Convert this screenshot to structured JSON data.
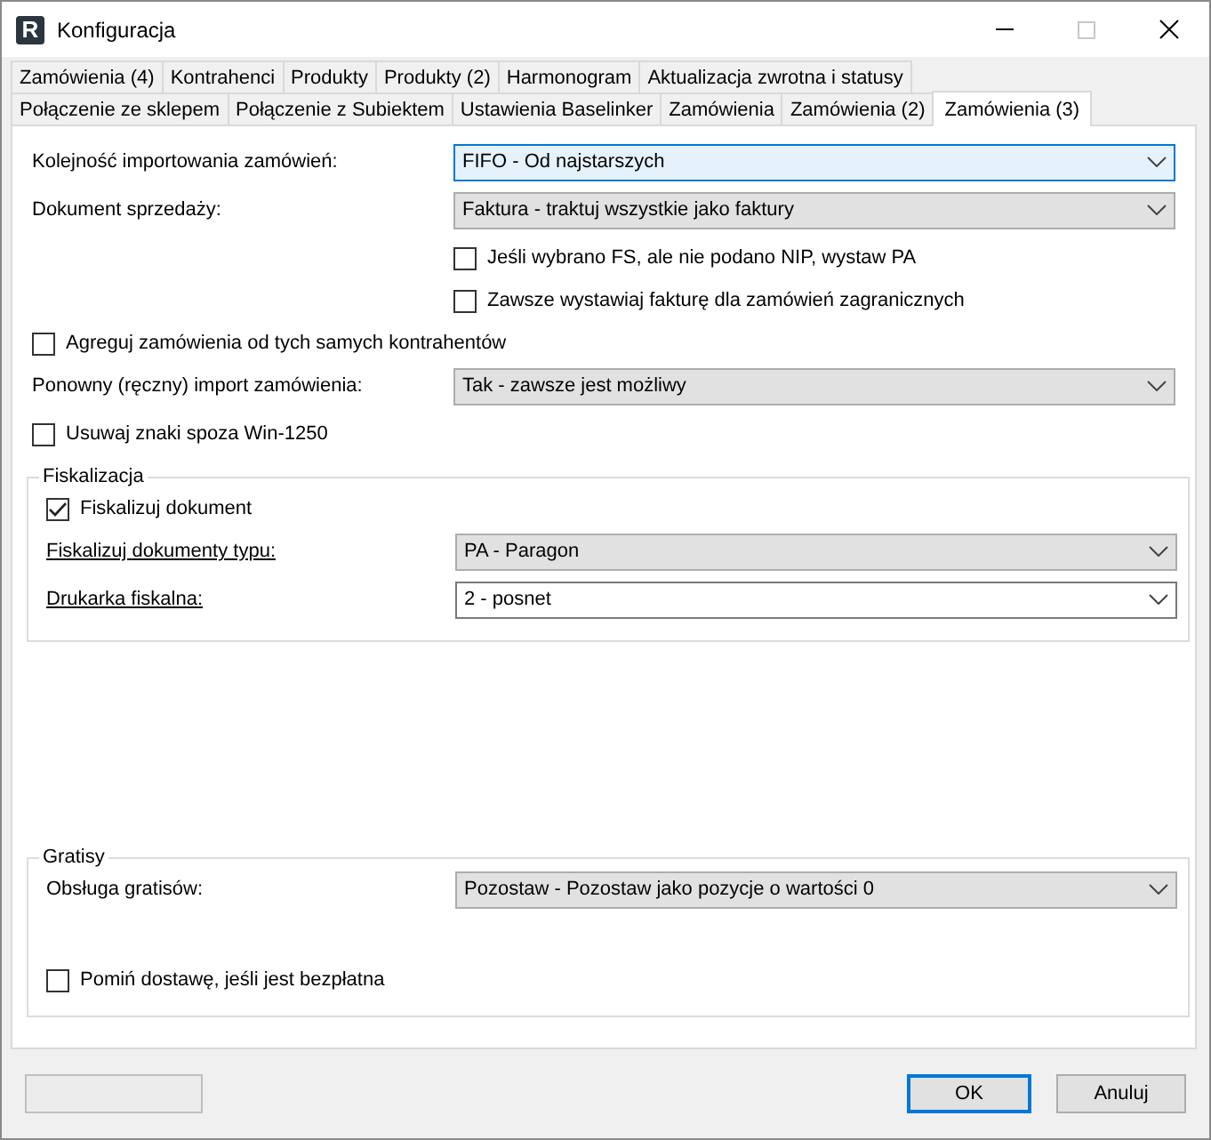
{
  "window": {
    "logo": "R",
    "title": "Konfiguracja"
  },
  "tab_rows": [
    {
      "tabs": [
        {
          "label": "Zamówienia (4)",
          "selected": false
        },
        {
          "label": "Kontrahenci",
          "selected": false
        },
        {
          "label": "Produkty",
          "selected": false
        },
        {
          "label": "Produkty (2)",
          "selected": false
        },
        {
          "label": "Harmonogram",
          "selected": false
        },
        {
          "label": "Aktualizacja zwrotna i statusy",
          "selected": false
        }
      ]
    },
    {
      "tabs": [
        {
          "label": "Połączenie ze sklepem",
          "selected": false
        },
        {
          "label": "Połączenie z Subiektem",
          "selected": false
        },
        {
          "label": "Ustawienia Baselinker",
          "selected": false
        },
        {
          "label": "Zamówienia",
          "selected": false
        },
        {
          "label": "Zamówienia (2)",
          "selected": false
        },
        {
          "label": "Zamówienia (3)",
          "selected": true
        }
      ]
    }
  ],
  "settings": [
    {
      "kind": "combo",
      "label": "Kolejność importowania zamówień:",
      "value": "FIFO - Od najstarszych",
      "focused": true,
      "editable": false,
      "underlined": false
    },
    {
      "kind": "combo",
      "label": "Dokument sprzedaży:",
      "value": "Faktura - traktuj wszystkie jako faktury",
      "focused": false,
      "editable": false,
      "underlined": false
    },
    {
      "kind": "option",
      "label": "Jeśli wybrano FS, ale nie podano NIP, wystaw PA",
      "checked": false
    },
    {
      "kind": "option",
      "label": "Zawsze wystawiaj fakturę dla zamówień zagranicznych",
      "checked": false
    },
    {
      "kind": "checkbox",
      "label": "Agreguj zamówienia od tych samych kontrahentów",
      "checked": false
    },
    {
      "kind": "combo",
      "label": "Ponowny (ręczny) import zamówienia:",
      "value": "Tak - zawsze jest możliwy",
      "focused": false,
      "editable": false,
      "underlined": false
    },
    {
      "kind": "checkbox",
      "label": "Usuwaj znaki spoza Win-1250",
      "checked": false
    }
  ],
  "groups": [
    {
      "title": "Fiskalizacja",
      "items": [
        {
          "kind": "checkbox",
          "label": "Fiskalizuj dokument",
          "checked": true
        },
        {
          "kind": "combo",
          "label": "Fiskalizuj dokumenty typu:",
          "value": "PA - Paragon",
          "focused": false,
          "editable": false,
          "underlined": true
        },
        {
          "kind": "combo",
          "label": "Drukarka fiskalna:",
          "value": "2 - posnet",
          "focused": false,
          "editable": true,
          "underlined": true
        }
      ]
    },
    {
      "title": "Gratisy",
      "items": [
        {
          "kind": "combo",
          "label": "Obsługa gratisów:",
          "value": "Pozostaw - Pozostaw jako pozycje o wartości 0",
          "focused": false,
          "editable": false,
          "underlined": false
        },
        {
          "kind": "spacer"
        },
        {
          "kind": "checkbox",
          "label": "Pomiń dostawę, jeśli jest bezpłatna",
          "checked": false
        }
      ]
    }
  ],
  "footer": {
    "left_button": {
      "disabled": true
    },
    "buttons": [
      {
        "label": "OK",
        "default": true
      },
      {
        "label": "Anuluj",
        "default": false
      }
    ]
  }
}
